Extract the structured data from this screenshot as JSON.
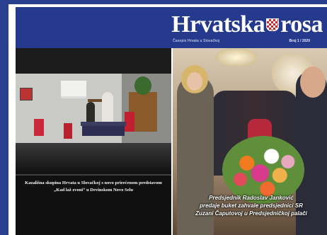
{
  "masthead": {
    "logo_left": "Hrvatska",
    "logo_right": "rosa",
    "subline": "Časopis Hrvata u Slovačkoj",
    "issue": "Broj 1 / 2020"
  },
  "left_article": {
    "caption": "Kazališna skupina Hrvata u Slovačkoj s novo prirećenom predstavom „Kad laž zvoni“ u Devinskom Novo Selu"
  },
  "right_article": {
    "caption_line1": "Predsjednik Radoslav Janković",
    "caption_line2": "predaje buket zahvale predsjednici SR",
    "caption_line3": "Zuzani Čaputovoj u Predsjedničkoj palači"
  },
  "colors": {
    "brand_blue": "#253a8c",
    "accent_red": "#d2232a"
  }
}
